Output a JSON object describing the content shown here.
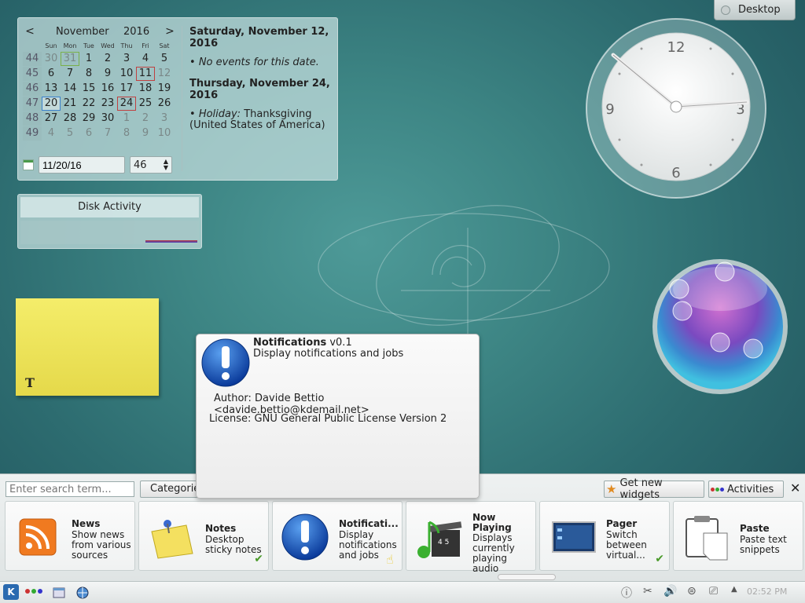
{
  "toolbox": {
    "label": "Desktop"
  },
  "calendar": {
    "month": "November",
    "year": "2016",
    "prev": "<",
    "next": ">",
    "weekdays": [
      "Sun",
      "Mon",
      "Tue",
      "Wed",
      "Thu",
      "Fri",
      "Sat"
    ],
    "weeks": [
      {
        "wk": "44",
        "days": [
          "30",
          "31",
          "1",
          "2",
          "3",
          "4",
          "5"
        ]
      },
      {
        "wk": "45",
        "days": [
          "6",
          "7",
          "8",
          "9",
          "10",
          "11",
          "12"
        ]
      },
      {
        "wk": "46",
        "days": [
          "13",
          "14",
          "15",
          "16",
          "17",
          "18",
          "19"
        ]
      },
      {
        "wk": "47",
        "days": [
          "20",
          "21",
          "22",
          "23",
          "24",
          "25",
          "26"
        ]
      },
      {
        "wk": "48",
        "days": [
          "27",
          "28",
          "29",
          "30",
          "1",
          "2",
          "3"
        ]
      },
      {
        "wk": "49",
        "days": [
          "4",
          "5",
          "6",
          "7",
          "8",
          "9",
          "10"
        ]
      }
    ],
    "date_value": "11/20/16",
    "week_value": "46",
    "events": [
      {
        "heading": "Saturday, November 12, 2016",
        "text": "No events for this date."
      },
      {
        "heading": "Thursday, November 24, 2016",
        "kind": "Holiday:",
        "text": "Thanksgiving (United States of America)"
      }
    ]
  },
  "disk": {
    "title": "Disk Activity"
  },
  "note": {
    "glyph": "T"
  },
  "clock": {
    "n12": "12",
    "n3": "3",
    "n6": "6",
    "n9": "9"
  },
  "tooltip": {
    "name": "Notifications",
    "version": "v0.1",
    "description": "Display notifications and jobs",
    "author": "Author: Davide Bettio <davide.bettio@kdemail.net>",
    "license": "License: GNU General Public License Version 2"
  },
  "explorer": {
    "search_placeholder": "Enter search term...",
    "categories_label": "Categories",
    "get_widgets_label": "Get new widgets",
    "activities_label": "Activities",
    "close": "✕",
    "cards": [
      {
        "name": "News",
        "desc": "Show news from various sources"
      },
      {
        "name": "Notes",
        "desc": "Desktop sticky notes"
      },
      {
        "name": "Notificati...",
        "desc": "Display notifications and jobs"
      },
      {
        "name": "Now Playing",
        "desc": "Displays currently playing audio"
      },
      {
        "name": "Pager",
        "desc": "Switch between virtual..."
      },
      {
        "name": "Paste",
        "desc": "Paste text snippets"
      }
    ]
  },
  "panel": {
    "clock": "02:52 PM",
    "k": "K"
  }
}
